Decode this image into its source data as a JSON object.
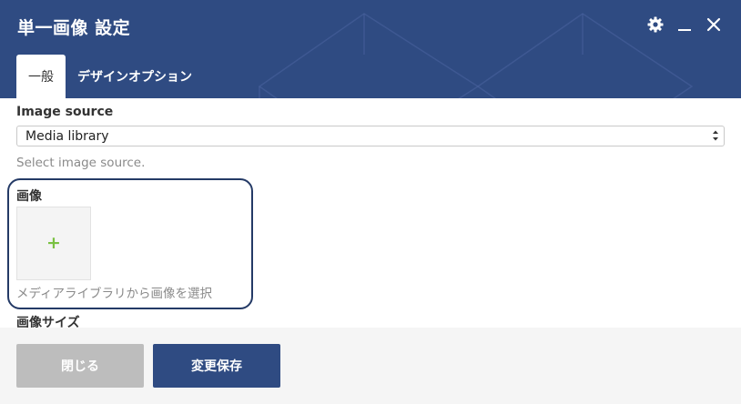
{
  "window": {
    "title": "単一画像 設定",
    "controls": {
      "settings_icon": "gear-icon",
      "minimize_icon": "minimize-icon",
      "close_icon": "close-icon"
    }
  },
  "tabs": [
    {
      "label": "一般",
      "active": true
    },
    {
      "label": "デザインオプション",
      "active": false
    }
  ],
  "form": {
    "image_source": {
      "label": "Image source",
      "value": "Media library",
      "help": "Select image source."
    },
    "image": {
      "label": "画像",
      "add_symbol": "+",
      "help": "メディアライブラリから画像を選択"
    },
    "image_size": {
      "label": "画像サイズ"
    }
  },
  "footer": {
    "close_label": "閉じる",
    "save_label": "変更保存"
  },
  "colors": {
    "header": "#2f4b82",
    "primary_button": "#2f4b82",
    "disabled_button": "#bdbdbd",
    "add_icon": "#7ac142",
    "highlight_border": "#243a66"
  }
}
